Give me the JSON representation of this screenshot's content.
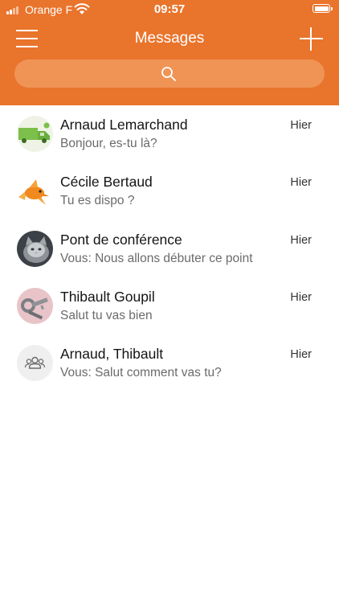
{
  "status_bar": {
    "carrier": "Orange F",
    "time": "09:57"
  },
  "header": {
    "title": "Messages",
    "menu_icon": "hamburger-menu-icon",
    "add_icon": "plus-icon",
    "search_icon": "search-icon"
  },
  "colors": {
    "header_background": "#e9742c",
    "search_background": "#f09456",
    "name_text": "#141414",
    "preview_text": "#6b6b6b"
  },
  "conversations": [
    {
      "name": "Arnaud Lemarchand",
      "preview": "Bonjour, es-tu là?",
      "time": "Hier",
      "avatar": "green-truck-avatar"
    },
    {
      "name": "Cécile Bertaud",
      "preview": "Tu es dispo ?",
      "time": "Hier",
      "avatar": "goldfish-avatar"
    },
    {
      "name": "Pont de conférence",
      "preview": "Vous: Nous allons débuter ce point",
      "time": "Hier",
      "avatar": "cat-photo-avatar"
    },
    {
      "name": "Thibault Goupil",
      "preview": "Salut tu vas bien",
      "time": "Hier",
      "avatar": "keys-photo-avatar"
    },
    {
      "name": "Arnaud, Thibault",
      "preview": "Vous: Salut comment vas tu?",
      "time": "Hier",
      "avatar": "group-icon"
    }
  ]
}
